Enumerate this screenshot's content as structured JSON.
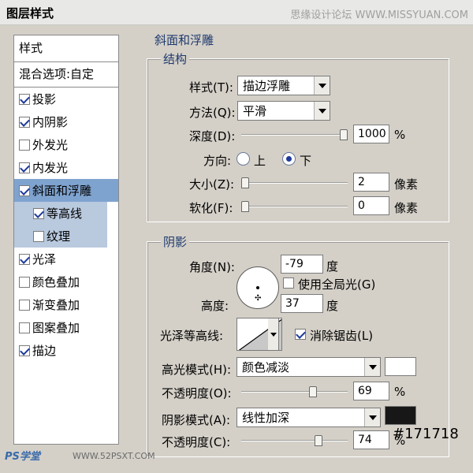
{
  "window": {
    "title": "图层样式",
    "watermark": "思缘设计论坛 WWW.MISSYUAN.COM"
  },
  "styles_panel": {
    "header": "样式",
    "blend_options": "混合选项:自定",
    "items": [
      {
        "label": "投影",
        "checked": true
      },
      {
        "label": "内阴影",
        "checked": true
      },
      {
        "label": "外发光",
        "checked": false
      },
      {
        "label": "内发光",
        "checked": true
      },
      {
        "label": "斜面和浮雕",
        "checked": true,
        "selected": true
      },
      {
        "label": "等高线",
        "checked": true,
        "sub": true
      },
      {
        "label": "纹理",
        "checked": false,
        "sub": true
      },
      {
        "label": "光泽",
        "checked": true
      },
      {
        "label": "颜色叠加",
        "checked": false
      },
      {
        "label": "渐变叠加",
        "checked": false
      },
      {
        "label": "图案叠加",
        "checked": false
      },
      {
        "label": "描边",
        "checked": true
      }
    ]
  },
  "bevel": {
    "section_title": "斜面和浮雕",
    "structure": {
      "group_label": "结构",
      "style_label": "样式(T):",
      "style_value": "描边浮雕",
      "technique_label": "方法(Q):",
      "technique_value": "平滑",
      "depth_label": "深度(D):",
      "depth_value": "1000",
      "depth_unit": "%",
      "depth_level": 1.0,
      "direction_label": "方向:",
      "direction_up": "上",
      "direction_down": "下",
      "direction_selected": "下",
      "size_label": "大小(Z):",
      "size_value": "2",
      "size_unit": "像素",
      "size_level": 0.0,
      "soften_label": "软化(F):",
      "soften_value": "0",
      "soften_unit": "像素",
      "soften_level": 0.0
    },
    "shading": {
      "group_label": "阴影",
      "angle_label": "角度(N):",
      "angle_value": "-79",
      "angle_unit": "度",
      "global_light_label": "使用全局光(G)",
      "global_light_checked": false,
      "altitude_label": "高度:",
      "altitude_value": "37",
      "altitude_unit": "度",
      "gloss_contour_label": "光泽等高线:",
      "anti_alias_label": "消除锯齿(L)",
      "anti_alias_checked": true,
      "highlight_mode_label": "高光模式(H):",
      "highlight_mode_value": "颜色减淡",
      "highlight_color": "#ffffff",
      "highlight_opacity_label": "不透明度(O):",
      "highlight_opacity_value": "69",
      "highlight_opacity_unit": "%",
      "highlight_opacity_level": 0.69,
      "shadow_mode_label": "阴影模式(A):",
      "shadow_mode_value": "线性加深",
      "shadow_color": "#171718",
      "shadow_color_text": "#171718",
      "shadow_opacity_label": "不透明度(C):",
      "shadow_opacity_value": "74",
      "shadow_opacity_unit": "%",
      "shadow_opacity_level": 0.74
    }
  },
  "footer_watermark": {
    "logo": "PS学堂",
    "url": "WWW.52PSXT.COM"
  }
}
